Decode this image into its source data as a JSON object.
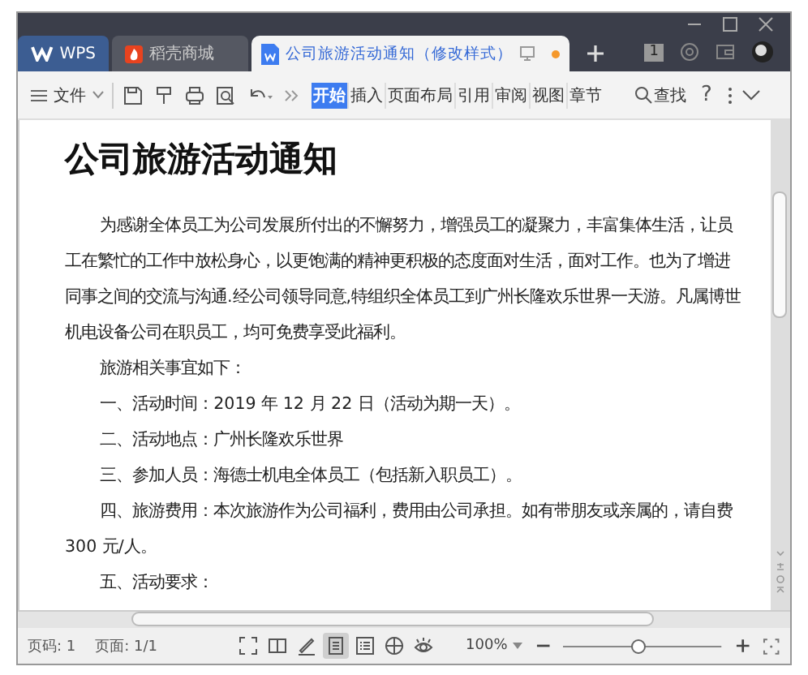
{
  "tabs": [
    {
      "label": "WPS",
      "kind": "home",
      "selected": false
    },
    {
      "label": "稻壳商城",
      "kind": "store",
      "selected": false
    },
    {
      "label": "公司旅游活动通知（修改样式）",
      "kind": "doc",
      "selected": true,
      "unsaved": true
    }
  ],
  "tab_counter": "1",
  "toolbar": {
    "file_menu": "文件",
    "ribbon_tabs": [
      {
        "label": "开始",
        "selected": true
      },
      {
        "label": "插入",
        "selected": false
      },
      {
        "label": "页面布局",
        "selected": false
      },
      {
        "label": "引用",
        "selected": false
      },
      {
        "label": "审阅",
        "selected": false
      },
      {
        "label": "视图",
        "selected": false
      },
      {
        "label": "章节",
        "selected": false
      }
    ],
    "search": "查找",
    "help": "?"
  },
  "document": {
    "title": "公司旅游活动通知",
    "paragraphs": [
      {
        "text": "为感谢全体员工为公司发展所付出的不懈努力，增强员工的凝聚力，丰富集体生活，让员工在繁忙的工作中放松身心，以更饱满的精神更积极的态度面对生活，面对工作。也为了增进同事之间的交流与沟通.经公司领导同意,特组织全体员工到广州长隆欢乐世界一天游。凡属博世机电设备公司在职员工，均可免费享受此福利。"
      },
      {
        "text": "旅游相关事宜如下："
      },
      {
        "text": "一、活动时间：2019 年 12 月 22 日（活动为期一天）。"
      },
      {
        "text": "二、活动地点：广州长隆欢乐世界"
      },
      {
        "text": "三、参加人员：海德士机电全体员工（包括新入职员工）。"
      },
      {
        "text": "四、旅游费用：本次旅游作为公司福利，费用由公司承担。如有带朋友或亲属的，请自费 300 元/人。"
      },
      {
        "text": "五、活动要求："
      }
    ]
  },
  "status_bar": {
    "page_number": "页码: 1",
    "pages": "页面: 1/1",
    "view_modes": [
      {
        "kind": "fullscreen",
        "selected": false
      },
      {
        "kind": "reading",
        "selected": false
      },
      {
        "kind": "edit",
        "selected": false
      },
      {
        "kind": "page",
        "selected": true
      },
      {
        "kind": "outline",
        "selected": false
      },
      {
        "kind": "web",
        "selected": false
      },
      {
        "kind": "eye",
        "selected": false
      }
    ],
    "zoom": "100%",
    "zoom_level": {
      "level": 0.48
    }
  }
}
